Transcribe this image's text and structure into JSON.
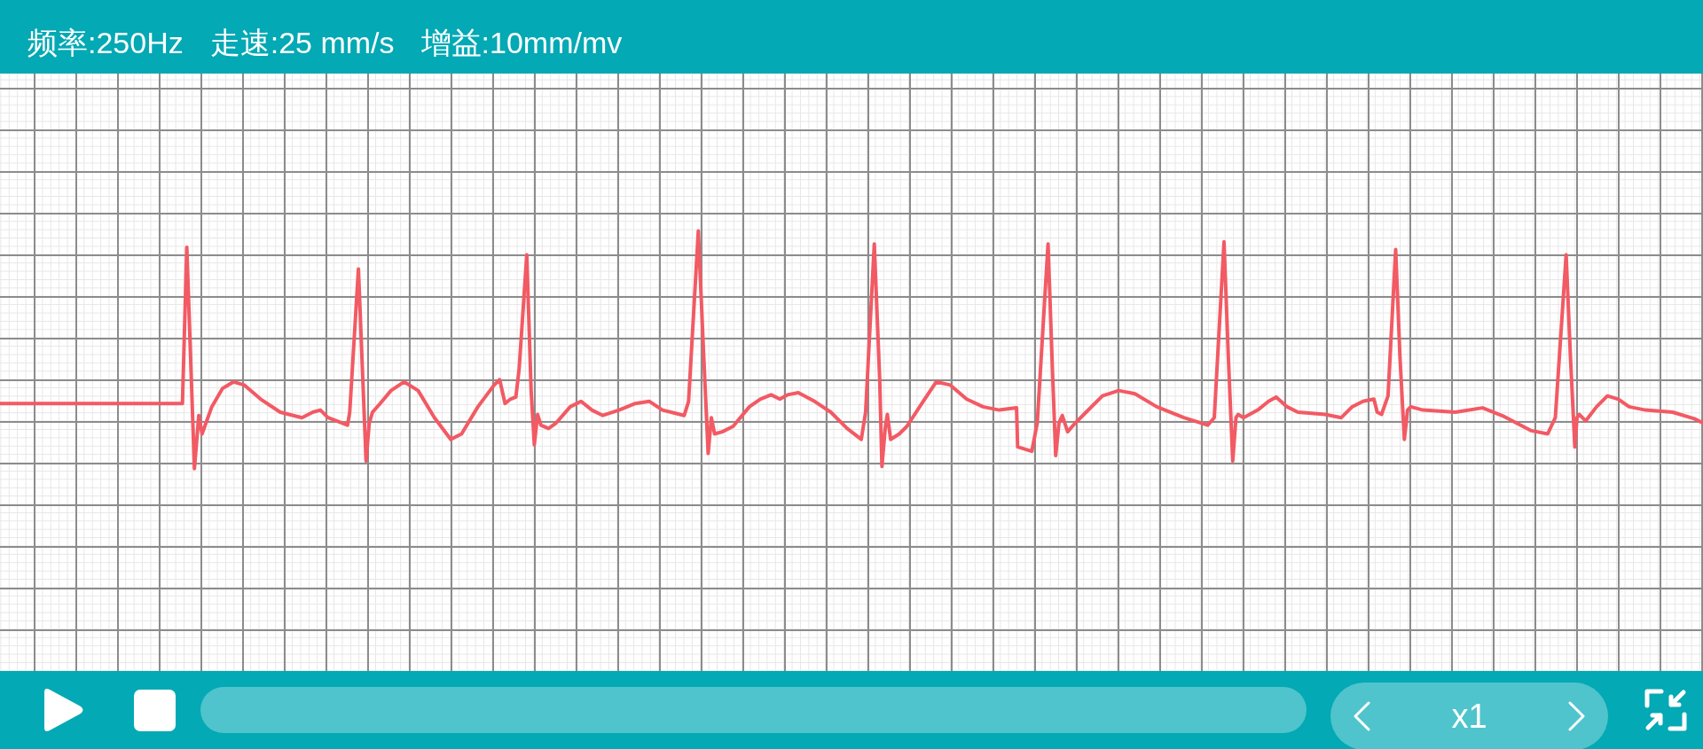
{
  "header": {
    "items": [
      "频率:250Hz",
      "走速:25 mm/s",
      "增益:10mm/mv"
    ]
  },
  "controls": {
    "progress": {
      "level": 0
    },
    "speed": {
      "label": "x1"
    }
  }
}
